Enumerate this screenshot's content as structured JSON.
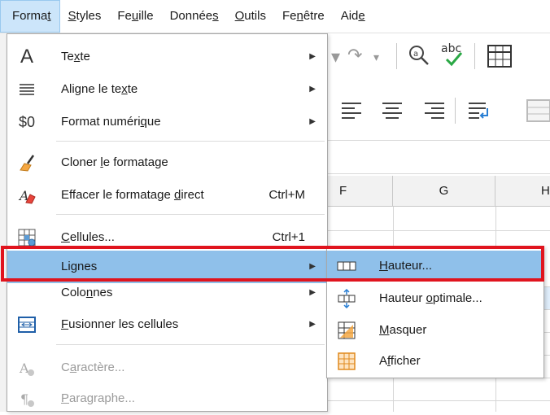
{
  "menubar": {
    "items": [
      "Format",
      "Styles",
      "Feuille",
      "Données",
      "Outils",
      "Fenêtre",
      "Aide"
    ]
  },
  "sheet": {
    "columns": [
      "F",
      "G",
      "H"
    ]
  },
  "format_menu": {
    "items": [
      {
        "icon": "text-a-icon",
        "label": "Texte",
        "submenu": true
      },
      {
        "icon": "align-text-icon",
        "label": "Aligne le texte",
        "submenu": true
      },
      {
        "icon": "number-format-icon",
        "label": "Format numérique",
        "submenu": true
      },
      {
        "icon": "clone-formatting-icon",
        "label": "Cloner le formatage"
      },
      {
        "icon": "clear-formatting-icon",
        "label": "Effacer le formatage direct",
        "shortcut": "Ctrl+M"
      },
      {
        "icon": "cells-icon",
        "label": "Cellules...",
        "shortcut": "Ctrl+1"
      },
      {
        "label": "Lignes",
        "submenu": true,
        "highlighted": true
      },
      {
        "label": "Colonnes",
        "submenu": true
      },
      {
        "icon": "merge-cells-icon",
        "label": "Fusionner les cellules",
        "submenu": true
      },
      {
        "icon": "character-icon",
        "label": "Caractère...",
        "disabled": true
      },
      {
        "icon": "paragraph-icon",
        "label": "Paragraphe...",
        "disabled": true
      }
    ],
    "icon_glyphs": {
      "text": "A",
      "number": "$0"
    }
  },
  "rows_submenu": {
    "items": [
      {
        "icon": "row-height-icon",
        "label": "Hauteur..."
      },
      {
        "icon": "optimal-height-icon",
        "label": "Hauteur optimale..."
      },
      {
        "icon": "hide-rows-icon",
        "label": "Masquer"
      },
      {
        "icon": "show-rows-icon",
        "label": "Afficher"
      }
    ]
  },
  "colors": {
    "highlight": "#8fc0ea",
    "annotation_box": "#e0141e",
    "menubar_active": "#cce5fa"
  }
}
